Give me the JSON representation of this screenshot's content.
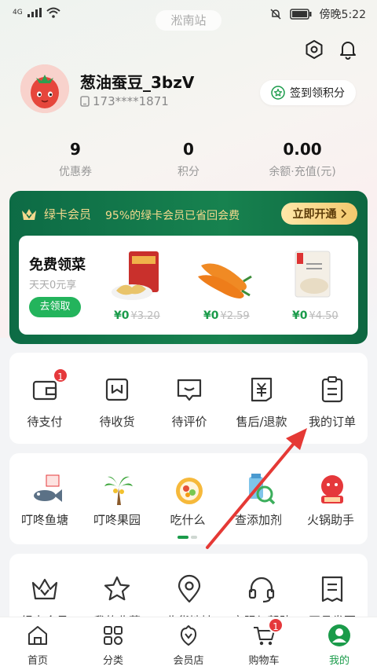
{
  "status_bar": {
    "network": "4G",
    "time": "傍晚5:22"
  },
  "header": {
    "store_name": "淞南站"
  },
  "profile": {
    "nickname": "葱油蚕豆_3bzV",
    "phone": "173****1871",
    "signin_label": "签到领积分"
  },
  "stats": [
    {
      "value": "9",
      "label": "优惠券"
    },
    {
      "value": "0",
      "label": "积分"
    },
    {
      "value": "0.00",
      "label": "余额·充值(元)"
    }
  ],
  "member": {
    "title": "绿卡会员",
    "slogan": "95%的绿卡会员已省回会费",
    "open_label": "立即开通",
    "free_title": "免费领菜",
    "free_sub": "天天0元享",
    "claim_label": "去领取",
    "products": [
      {
        "price": "¥0",
        "old_price": "¥3.20",
        "icon": "snack-bag-icon"
      },
      {
        "price": "¥0",
        "old_price": "¥2.59",
        "icon": "carrot-icon"
      },
      {
        "price": "¥0",
        "old_price": "¥4.50",
        "icon": "bowl-pack-icon"
      }
    ]
  },
  "orders": [
    {
      "label": "待支付",
      "icon": "wallet-icon",
      "badge": "1"
    },
    {
      "label": "待收货",
      "icon": "receive-box-icon"
    },
    {
      "label": "待评价",
      "icon": "review-icon"
    },
    {
      "label": "售后/退款",
      "icon": "refund-icon"
    },
    {
      "label": "我的订单",
      "icon": "order-list-icon"
    }
  ],
  "services": [
    {
      "label": "叮咚鱼塘",
      "icon": "fish-pond-icon"
    },
    {
      "label": "叮咚果园",
      "icon": "orchard-icon"
    },
    {
      "label": "吃什么",
      "icon": "food-plate-icon"
    },
    {
      "label": "查添加剂",
      "icon": "additive-check-icon"
    },
    {
      "label": "火锅助手",
      "icon": "hotpot-icon"
    }
  ],
  "tools": [
    {
      "label": "绿卡会员",
      "icon": "crown-icon"
    },
    {
      "label": "我的收藏",
      "icon": "star-icon"
    },
    {
      "label": "收货地址",
      "icon": "location-pin-icon"
    },
    {
      "label": "客服与帮助",
      "icon": "headset-icon"
    },
    {
      "label": "开具发票",
      "icon": "invoice-icon"
    }
  ],
  "nav": [
    {
      "label": "首页",
      "icon": "home-icon"
    },
    {
      "label": "分类",
      "icon": "category-icon"
    },
    {
      "label": "会员店",
      "icon": "member-store-icon"
    },
    {
      "label": "购物车",
      "icon": "cart-icon",
      "badge": "1"
    },
    {
      "label": "我的",
      "icon": "profile-icon"
    }
  ],
  "colors": {
    "brand_green": "#1a9b4a",
    "member_green": "#0d6b45",
    "gold": "#f4d98d",
    "badge_red": "#e5383b",
    "arrow_red": "#e53935"
  }
}
